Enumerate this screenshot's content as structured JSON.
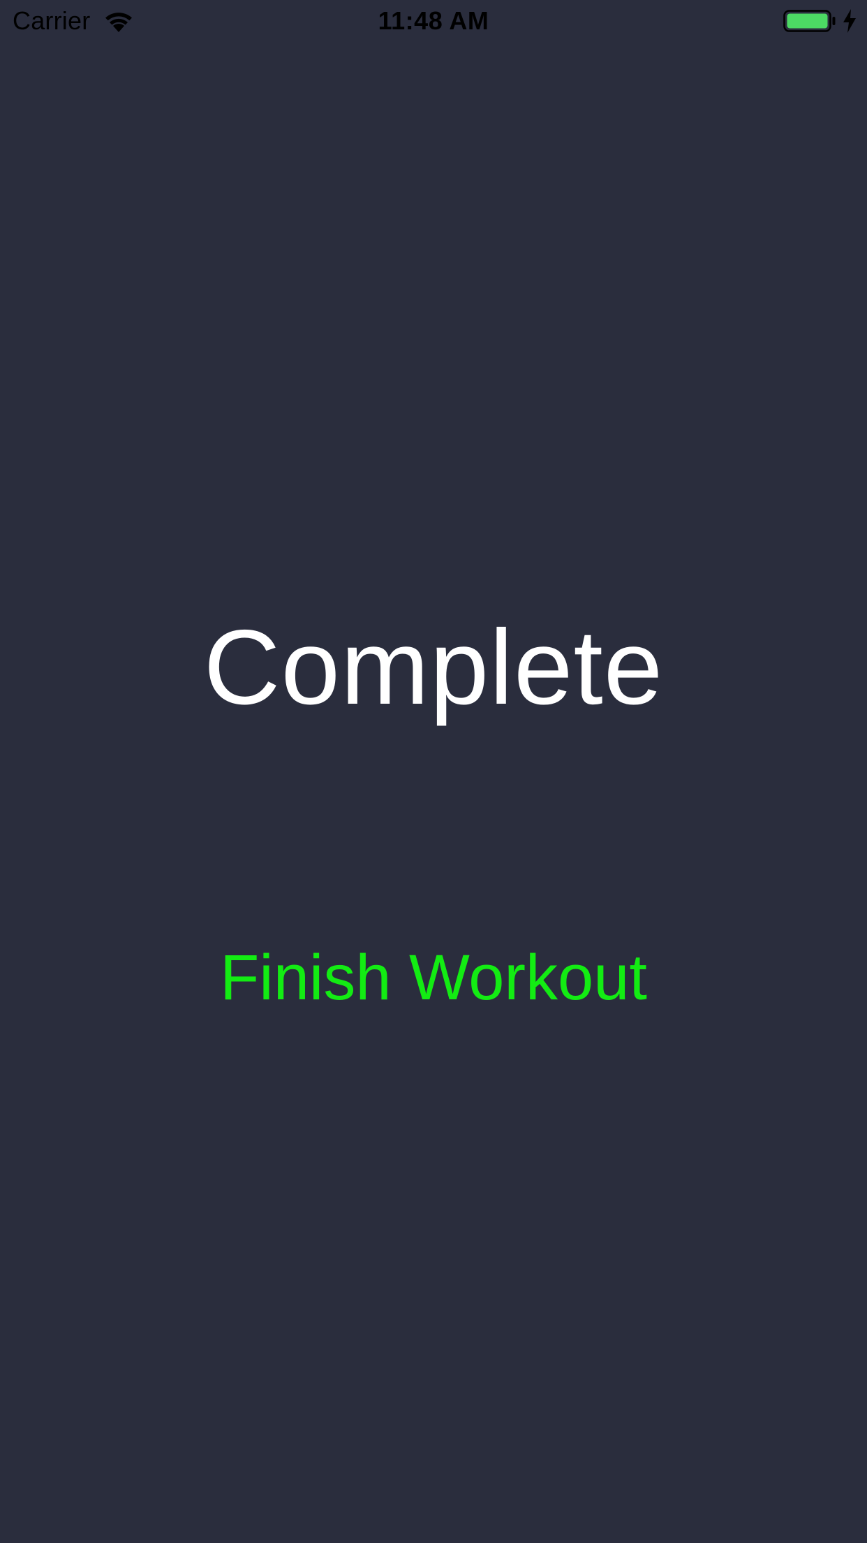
{
  "status_bar": {
    "carrier": "Carrier",
    "time": "11:48 AM",
    "wifi_icon": "wifi-icon",
    "battery_icon": "battery-icon",
    "charging_icon": "charging-bolt-icon",
    "battery_level": 1.0,
    "battery_color": "#4cd964"
  },
  "main": {
    "title": "Complete",
    "finish_button_label": "Finish Workout"
  },
  "colors": {
    "background": "#2a2d3d",
    "title": "#ffffff",
    "accent": "#13ec13",
    "status_text": "#000000"
  }
}
